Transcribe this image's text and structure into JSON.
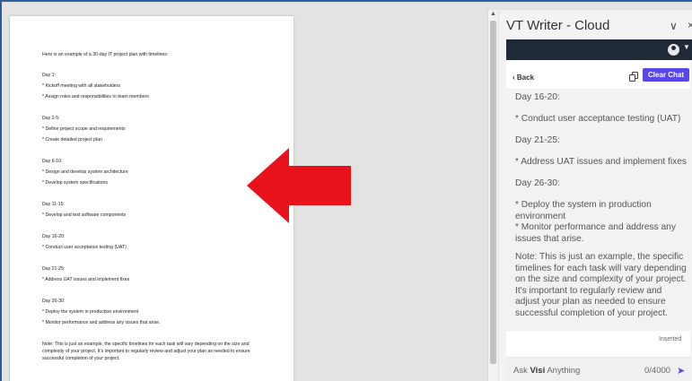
{
  "document": {
    "lines": [
      "Here is an example of a 30-day IT project plan with timelines:",
      "Day 1:",
      "* Kickoff meeting with all stakeholders",
      "* Assign roles and responsibilities to team members",
      "Day 2-5:",
      "* Define project scope and requirements",
      "* Create detailed project plan",
      "Day 6-10:",
      "* Design and develop system architecture",
      "* Develop system specifications",
      "Day 11-15:",
      "* Develop and test software components",
      "Day 16-20:",
      "* Conduct user acceptance testing (UAT)",
      "Day 21-25:",
      "* Address UAT issues and implement fixes",
      "Day 26-30:",
      "* Deploy the system in production environment",
      "* Monitor performance and address any issues that arise.",
      "Note: This is just an example, the specific timelines for each task will vary depending on the size and complexity of your project. It's important to regularly review and adjust your plan as needed to ensure successful completion of your project."
    ]
  },
  "colors": {
    "arrow": "#e8121a",
    "accent": "#5747e8",
    "dark_bar": "#1f2a36"
  },
  "panel": {
    "title": "VT Writer - Cloud",
    "chevron": "∨",
    "close": "×",
    "back_label": "‹ Back",
    "clear_chat_label": "Clear Chat",
    "message_lines": [
      "Day 16-20:",
      "* Conduct user acceptance testing (UAT)",
      "Day 21-25:",
      "* Address UAT issues and implement fixes",
      "Day 26-30:",
      "* Deploy the system in production environment\n* Monitor performance and address any issues that arise.",
      "Note: This is just an example, the specific timelines for each task will vary depending on the size and complexity of your project. It's important to regularly review and adjust your plan as needed to ensure successful completion of your project."
    ],
    "status": "Inserted",
    "ask_prefix": "Ask ",
    "ask_brand": "Visi",
    "ask_suffix": " Anything",
    "char_count": "0/4000",
    "send_icon": "send-icon"
  }
}
